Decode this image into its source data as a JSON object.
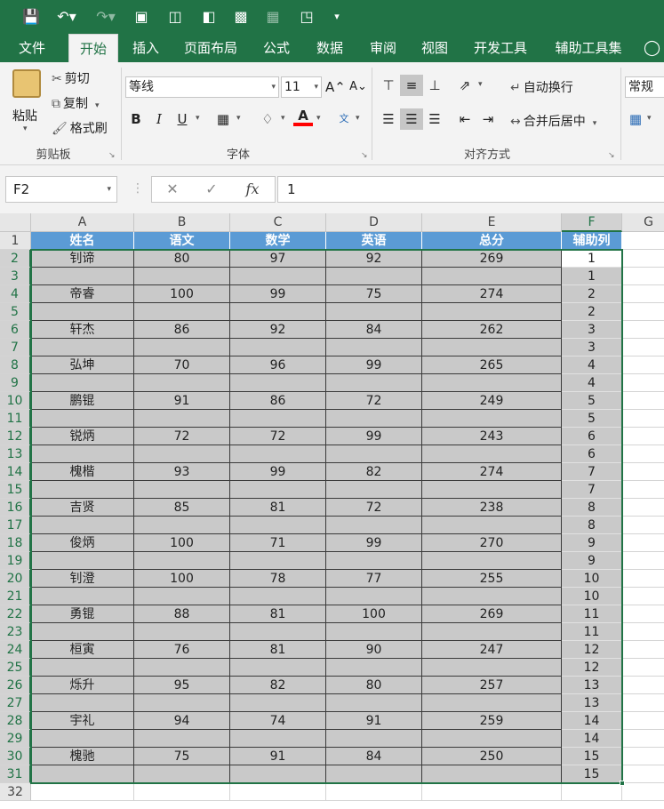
{
  "quick_access": {
    "save_icon": "save-icon",
    "undo_icon": "undo-icon",
    "redo_icon": "redo-icon"
  },
  "tabs": [
    "文件",
    "开始",
    "插入",
    "页面布局",
    "公式",
    "数据",
    "审阅",
    "视图",
    "开发工具",
    "辅助工具集"
  ],
  "active_tab": "开始",
  "ribbon": {
    "clipboard": {
      "paste": "粘贴",
      "cut": "剪切",
      "copy": "复制",
      "format_painter": "格式刷",
      "group_label": "剪贴板"
    },
    "font": {
      "font_name": "等线",
      "font_size": "11",
      "bold": "B",
      "italic": "I",
      "underline": "U",
      "group_label": "字体",
      "font_color": "#ff0000"
    },
    "alignment": {
      "wrap_text": "自动换行",
      "merge_center": "合并后居中",
      "group_label": "对齐方式"
    },
    "number": {
      "format": "常规"
    }
  },
  "formula_bar": {
    "name_box": "F2",
    "value": "1",
    "fx": "fx"
  },
  "columns": [
    "A",
    "B",
    "C",
    "D",
    "E",
    "F",
    "G"
  ],
  "selected_column": "F",
  "headers": [
    "姓名",
    "语文",
    "数学",
    "英语",
    "总分",
    "辅助列"
  ],
  "rows": [
    {
      "row": 2,
      "cells": [
        "钊谛",
        "80",
        "97",
        "92",
        "269",
        "1"
      ]
    },
    {
      "row": 3,
      "cells": [
        "",
        "",
        "",
        "",
        "",
        "1"
      ]
    },
    {
      "row": 4,
      "cells": [
        "帝睿",
        "100",
        "99",
        "75",
        "274",
        "2"
      ]
    },
    {
      "row": 5,
      "cells": [
        "",
        "",
        "",
        "",
        "",
        "2"
      ]
    },
    {
      "row": 6,
      "cells": [
        "轩杰",
        "86",
        "92",
        "84",
        "262",
        "3"
      ]
    },
    {
      "row": 7,
      "cells": [
        "",
        "",
        "",
        "",
        "",
        "3"
      ]
    },
    {
      "row": 8,
      "cells": [
        "弘坤",
        "70",
        "96",
        "99",
        "265",
        "4"
      ]
    },
    {
      "row": 9,
      "cells": [
        "",
        "",
        "",
        "",
        "",
        "4"
      ]
    },
    {
      "row": 10,
      "cells": [
        "鹏锟",
        "91",
        "86",
        "72",
        "249",
        "5"
      ]
    },
    {
      "row": 11,
      "cells": [
        "",
        "",
        "",
        "",
        "",
        "5"
      ]
    },
    {
      "row": 12,
      "cells": [
        "锐炳",
        "72",
        "72",
        "99",
        "243",
        "6"
      ]
    },
    {
      "row": 13,
      "cells": [
        "",
        "",
        "",
        "",
        "",
        "6"
      ]
    },
    {
      "row": 14,
      "cells": [
        "槐楷",
        "93",
        "99",
        "82",
        "274",
        "7"
      ]
    },
    {
      "row": 15,
      "cells": [
        "",
        "",
        "",
        "",
        "",
        "7"
      ]
    },
    {
      "row": 16,
      "cells": [
        "吉贤",
        "85",
        "81",
        "72",
        "238",
        "8"
      ]
    },
    {
      "row": 17,
      "cells": [
        "",
        "",
        "",
        "",
        "",
        "8"
      ]
    },
    {
      "row": 18,
      "cells": [
        "俊炳",
        "100",
        "71",
        "99",
        "270",
        "9"
      ]
    },
    {
      "row": 19,
      "cells": [
        "",
        "",
        "",
        "",
        "",
        "9"
      ]
    },
    {
      "row": 20,
      "cells": [
        "钊澄",
        "100",
        "78",
        "77",
        "255",
        "10"
      ]
    },
    {
      "row": 21,
      "cells": [
        "",
        "",
        "",
        "",
        "",
        "10"
      ]
    },
    {
      "row": 22,
      "cells": [
        "勇锟",
        "88",
        "81",
        "100",
        "269",
        "11"
      ]
    },
    {
      "row": 23,
      "cells": [
        "",
        "",
        "",
        "",
        "",
        "11"
      ]
    },
    {
      "row": 24,
      "cells": [
        "桓寅",
        "76",
        "81",
        "90",
        "247",
        "12"
      ]
    },
    {
      "row": 25,
      "cells": [
        "",
        "",
        "",
        "",
        "",
        "12"
      ]
    },
    {
      "row": 26,
      "cells": [
        "烁升",
        "95",
        "82",
        "80",
        "257",
        "13"
      ]
    },
    {
      "row": 27,
      "cells": [
        "",
        "",
        "",
        "",
        "",
        "13"
      ]
    },
    {
      "row": 28,
      "cells": [
        "宇礼",
        "94",
        "74",
        "91",
        "259",
        "14"
      ]
    },
    {
      "row": 29,
      "cells": [
        "",
        "",
        "",
        "",
        "",
        "14"
      ]
    },
    {
      "row": 30,
      "cells": [
        "槐驰",
        "75",
        "91",
        "84",
        "250",
        "15"
      ]
    },
    {
      "row": 31,
      "cells": [
        "",
        "",
        "",
        "",
        "",
        "15"
      ]
    },
    {
      "row": 32,
      "cells": [
        "",
        "",
        "",
        "",
        "",
        ""
      ]
    }
  ],
  "row_one_label": "1",
  "colors": {
    "excel_green": "#217346",
    "header_fill": "#5b9bd5",
    "data_fill": "#c9c9c9"
  }
}
